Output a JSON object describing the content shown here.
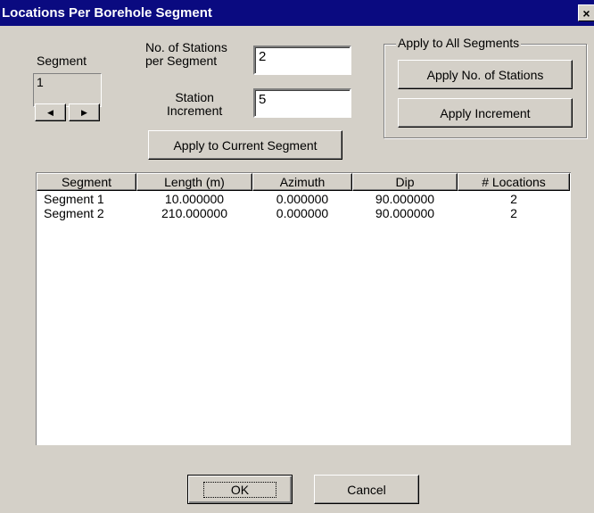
{
  "window": {
    "title": "Locations Per Borehole Segment",
    "close_glyph": "×"
  },
  "segment": {
    "label": "Segment",
    "value": "1",
    "prev_glyph": "◀",
    "next_glyph": "▶"
  },
  "stations": {
    "label_line1": "No. of Stations",
    "label_line2": "per Segment",
    "value": "2"
  },
  "increment": {
    "label_line1": "Station",
    "label_line2": "Increment",
    "value": "5"
  },
  "apply_current_label": "Apply to Current Segment",
  "apply_all": {
    "group_label": "Apply to All Segments",
    "stations_button": "Apply No. of Stations",
    "increment_button": "Apply Increment"
  },
  "table": {
    "columns": [
      "Segment",
      "Length (m)",
      "Azimuth",
      "Dip",
      "# Locations"
    ],
    "rows": [
      [
        "Segment 1",
        "10.000000",
        "0.000000",
        "90.000000",
        "2"
      ],
      [
        "Segment 2",
        "210.000000",
        "0.000000",
        "90.000000",
        "2"
      ]
    ]
  },
  "footer": {
    "ok_label": "OK",
    "cancel_label": "Cancel"
  }
}
